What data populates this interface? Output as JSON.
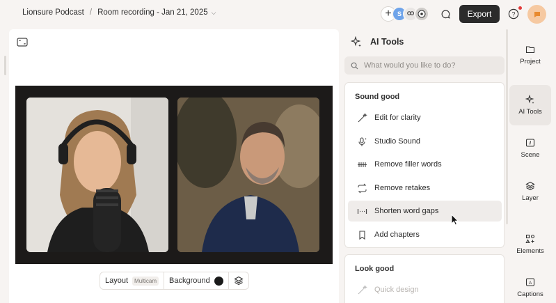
{
  "breadcrumb": {
    "project": "Lionsure Podcast",
    "separator": "/",
    "file": "Room recording - Jan 21, 2025"
  },
  "header": {
    "collaborator_initial": "S",
    "export_label": "Export",
    "colors": {
      "export_bg": "#2b2b2b",
      "notification": "#e23a3a",
      "avatar_bg": "#f6c9a1",
      "collaborator": "#6fa4ea"
    }
  },
  "canvas": {
    "controls": {
      "layout_label": "Layout",
      "layout_tag": "Multicam",
      "background_label": "Background",
      "background_color": "#1a1a1a"
    }
  },
  "ai_tools": {
    "title": "AI Tools",
    "search_placeholder": "What would you like to do?",
    "sections": [
      {
        "heading": "Sound good",
        "items": [
          {
            "label": "Edit for clarity",
            "icon": "wand-icon"
          },
          {
            "label": "Studio Sound",
            "icon": "mic-sparkle-icon"
          },
          {
            "label": "Remove filler words",
            "icon": "strikethrough-filler-icon"
          },
          {
            "label": "Remove retakes",
            "icon": "repeat-icon"
          },
          {
            "label": "Shorten word gaps",
            "icon": "gap-icon",
            "hovered": true
          },
          {
            "label": "Add chapters",
            "icon": "bookmark-icon"
          }
        ]
      },
      {
        "heading": "Look good",
        "items": [
          {
            "label": "Quick design",
            "icon": "wand-icon",
            "disabled": true
          }
        ]
      }
    ]
  },
  "rail": {
    "items": [
      {
        "label": "Project",
        "icon": "folder-icon"
      },
      {
        "label": "AI Tools",
        "icon": "sparkle-icon",
        "active": true
      },
      {
        "label": "Scene",
        "icon": "scene-icon"
      },
      {
        "label": "Layer",
        "icon": "layers-icon"
      },
      {
        "label": "Elements",
        "icon": "elements-icon"
      },
      {
        "label": "Captions",
        "icon": "captions-icon"
      }
    ]
  }
}
